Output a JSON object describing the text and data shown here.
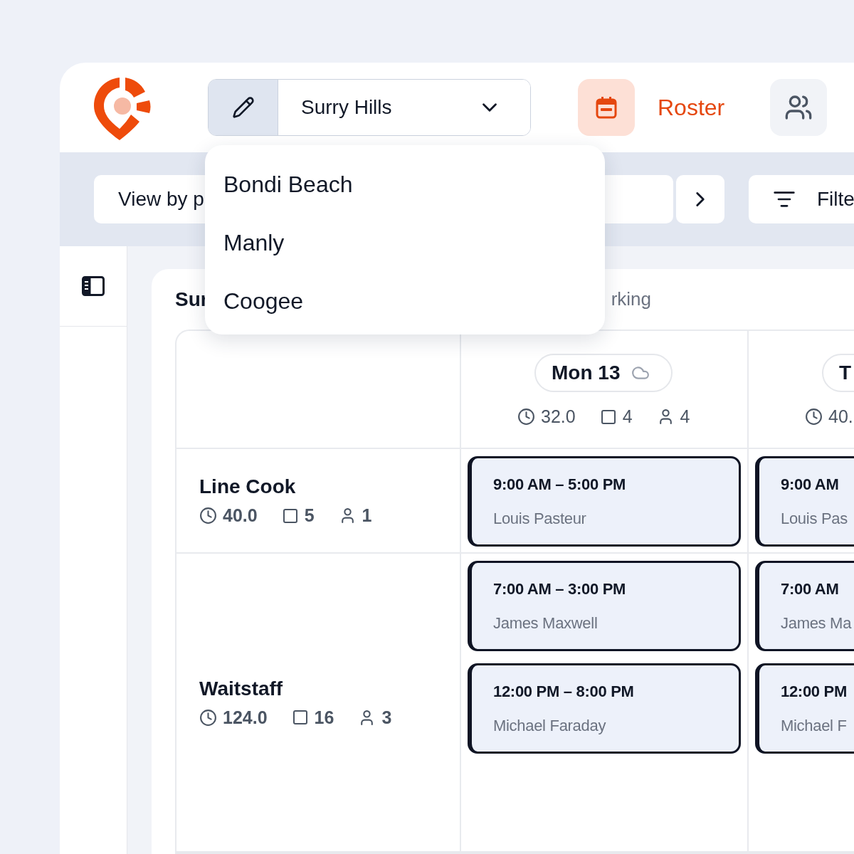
{
  "header": {
    "location": "Surry Hills",
    "nav_label": "Roster"
  },
  "location_menu": {
    "open": true,
    "options": [
      {
        "label": "Bondi Beach"
      },
      {
        "label": "Manly"
      },
      {
        "label": "Coogee"
      }
    ]
  },
  "toolbar": {
    "view_by": "View by p",
    "filter": "Filte"
  },
  "card": {
    "title": "Sur",
    "subtitle": "rking"
  },
  "days": [
    {
      "label": "Mon 13",
      "cloud": true,
      "hours": "32.0",
      "shifts": "4",
      "staff": "4"
    },
    {
      "label": "T",
      "hours": "40."
    }
  ],
  "roles": [
    {
      "name": "Line Cook",
      "hours": "40.0",
      "shifts": "5",
      "staff": "1",
      "slots": [
        [
          {
            "time": "9:00 AM – 5:00 PM",
            "employee": "Louis Pasteur"
          },
          {
            "time": "9:00 AM",
            "employee": "Louis Pas"
          }
        ]
      ]
    },
    {
      "name": "Waitstaff",
      "hours": "124.0",
      "shifts": "16",
      "staff": "3",
      "slots": [
        [
          {
            "time": "7:00 AM – 3:00 PM",
            "employee": "James Maxwell"
          },
          {
            "time": "7:00 AM",
            "employee": "James Ma"
          }
        ],
        [
          {
            "time": "12:00 PM – 8:00 PM",
            "employee": "Michael Faraday"
          },
          {
            "time": "12:00 PM",
            "employee": "Michael F"
          }
        ]
      ]
    }
  ]
}
